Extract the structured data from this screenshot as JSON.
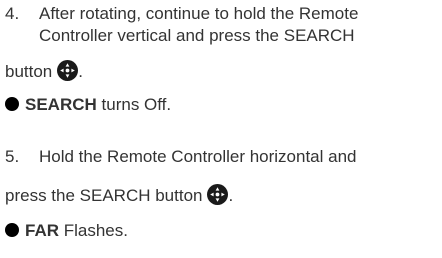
{
  "steps": [
    {
      "number": "4.",
      "lines": [
        "After rotating, continue to hold the Remote",
        "Controller vertical and press the SEARCH",
        "button"
      ],
      "after_icon": ".",
      "result_bold": "SEARCH",
      "result_rest": " turns Off."
    },
    {
      "number": "5.",
      "lines": [
        "Hold the Remote Controller horizontal and",
        "press the SEARCH button"
      ],
      "after_icon": ".",
      "result_bold": "FAR",
      "result_rest": " Flashes."
    }
  ],
  "icons": {
    "search_button": "search-button-icon",
    "bullet": "filled-circle-bullet"
  },
  "colors": {
    "text": "#333333",
    "bullet": "#000000",
    "icon_fill": "#1a1a1a"
  }
}
